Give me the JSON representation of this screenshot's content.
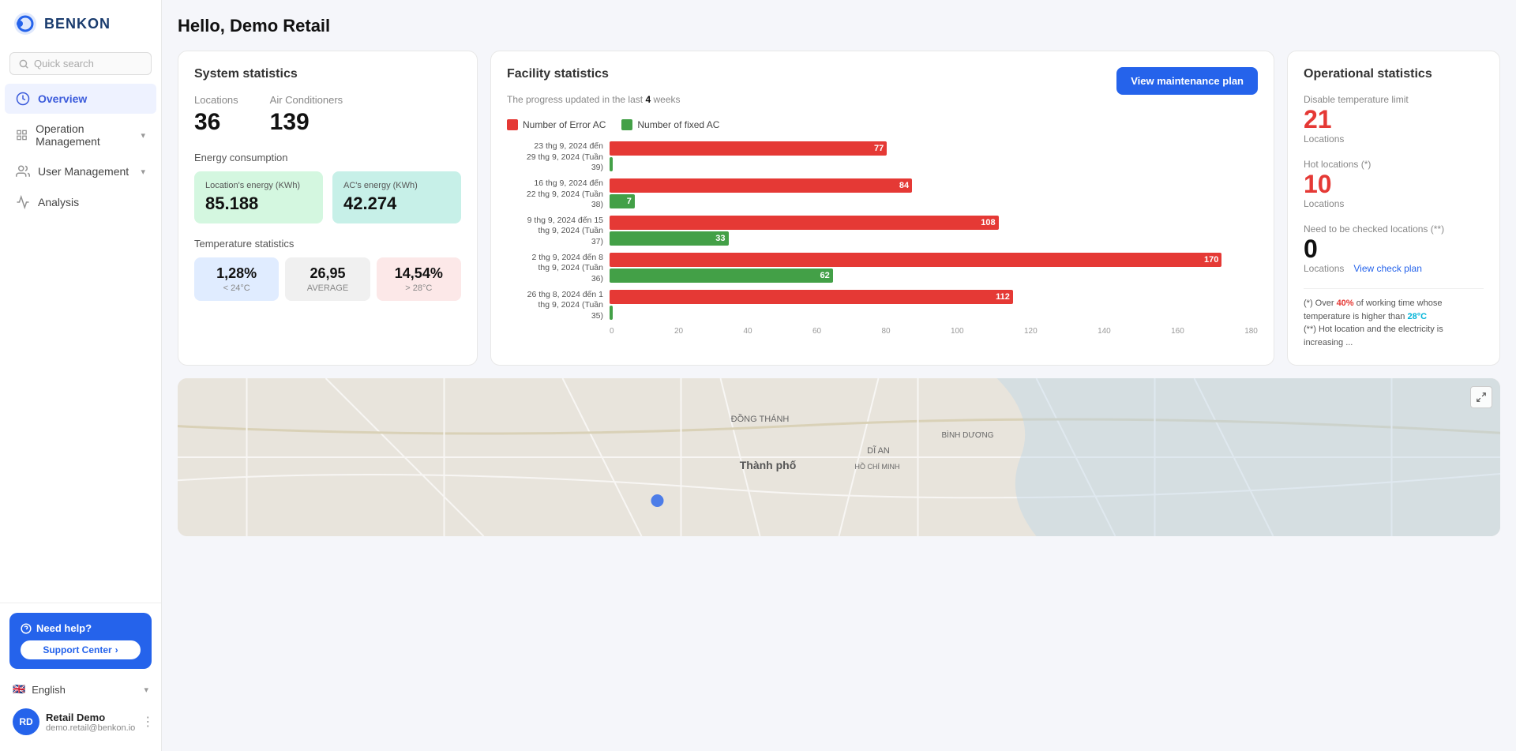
{
  "sidebar": {
    "logo_text": "BENKON",
    "search_placeholder": "Quick search",
    "nav_items": [
      {
        "id": "overview",
        "label": "Overview",
        "active": true,
        "icon": "chart-icon"
      },
      {
        "id": "operation",
        "label": "Operation Management",
        "active": false,
        "icon": "grid-icon",
        "has_chevron": true
      },
      {
        "id": "user",
        "label": "User Management",
        "active": false,
        "icon": "users-icon",
        "has_chevron": true
      },
      {
        "id": "analysis",
        "label": "Analysis",
        "active": false,
        "icon": "activity-icon"
      }
    ],
    "help": {
      "title": "Need help?",
      "support_label": "Support Center",
      "chevron": "›"
    },
    "language": {
      "flag": "🇬🇧",
      "label": "English"
    },
    "user": {
      "initials": "RD",
      "name": "Retail Demo",
      "email": "demo.retail@benkon.io"
    }
  },
  "page": {
    "title": "Hello, Demo Retail"
  },
  "system_stats": {
    "card_title": "System statistics",
    "locations_label": "Locations",
    "locations_value": "36",
    "ac_label": "Air Conditioners",
    "ac_value": "139",
    "energy_title": "Energy consumption",
    "location_energy_label": "Location's energy (KWh)",
    "location_energy_value": "85.188",
    "ac_energy_label": "AC's energy (KWh)",
    "ac_energy_value": "42.274",
    "temp_title": "Temperature statistics",
    "temp_cold_value": "1,28%",
    "temp_cold_sub": "< 24°C",
    "temp_avg_value": "26,95",
    "temp_avg_sub": "AVERAGE",
    "temp_hot_value": "14,54%",
    "temp_hot_sub": "> 28°C"
  },
  "facility_stats": {
    "card_title": "Facility statistics",
    "subtitle": "The progress updated in the last ",
    "subtitle_weeks": "4",
    "subtitle_end": " weeks",
    "view_btn_label": "View maintenance plan",
    "legend_error": "Number of Error AC",
    "legend_fixed": "Number of fixed AC",
    "bars": [
      {
        "label": "23 thg 9, 2024 đến\n29 thg 9, 2024 (Tuần\n39)",
        "error": 77,
        "fixed": 0,
        "max": 180
      },
      {
        "label": "16 thg 9, 2024 đến\n22 thg 9, 2024 (Tuần\n38)",
        "error": 84,
        "fixed": 7,
        "max": 180
      },
      {
        "label": "9 thg 9, 2024 đến 15\nthg 9, 2024 (Tuần\n37)",
        "error": 108,
        "fixed": 33,
        "max": 180
      },
      {
        "label": "2 thg 9, 2024 đến 8\nthg 9, 2024 (Tuần\n36)",
        "error": 170,
        "fixed": 62,
        "max": 180
      },
      {
        "label": "26 thg 8, 2024 đến 1\nthg 9, 2024 (Tuần\n35)",
        "error": 112,
        "fixed": 0,
        "max": 180
      }
    ],
    "x_axis": [
      "0",
      "20",
      "40",
      "60",
      "80",
      "100",
      "120",
      "140",
      "160",
      "180"
    ]
  },
  "operational_stats": {
    "card_title": "Operational statistics",
    "disable_temp_label": "Disable temperature limit",
    "disable_temp_value": "21",
    "disable_temp_sub": "Locations",
    "hot_loc_label": "Hot locations (*)",
    "hot_loc_value": "10",
    "hot_loc_sub": "Locations",
    "check_loc_label": "Need to be checked locations (**)",
    "check_loc_value": "0",
    "check_loc_sub": "Locations",
    "view_check_label": "View check plan",
    "footnote1": "(*) Over ",
    "footnote1_pct": "40%",
    "footnote1_mid": " of working time whose temperature is higher than ",
    "footnote1_temp": "28°C",
    "footnote2": "(**) Hot location and the electricity is increasing ..."
  }
}
